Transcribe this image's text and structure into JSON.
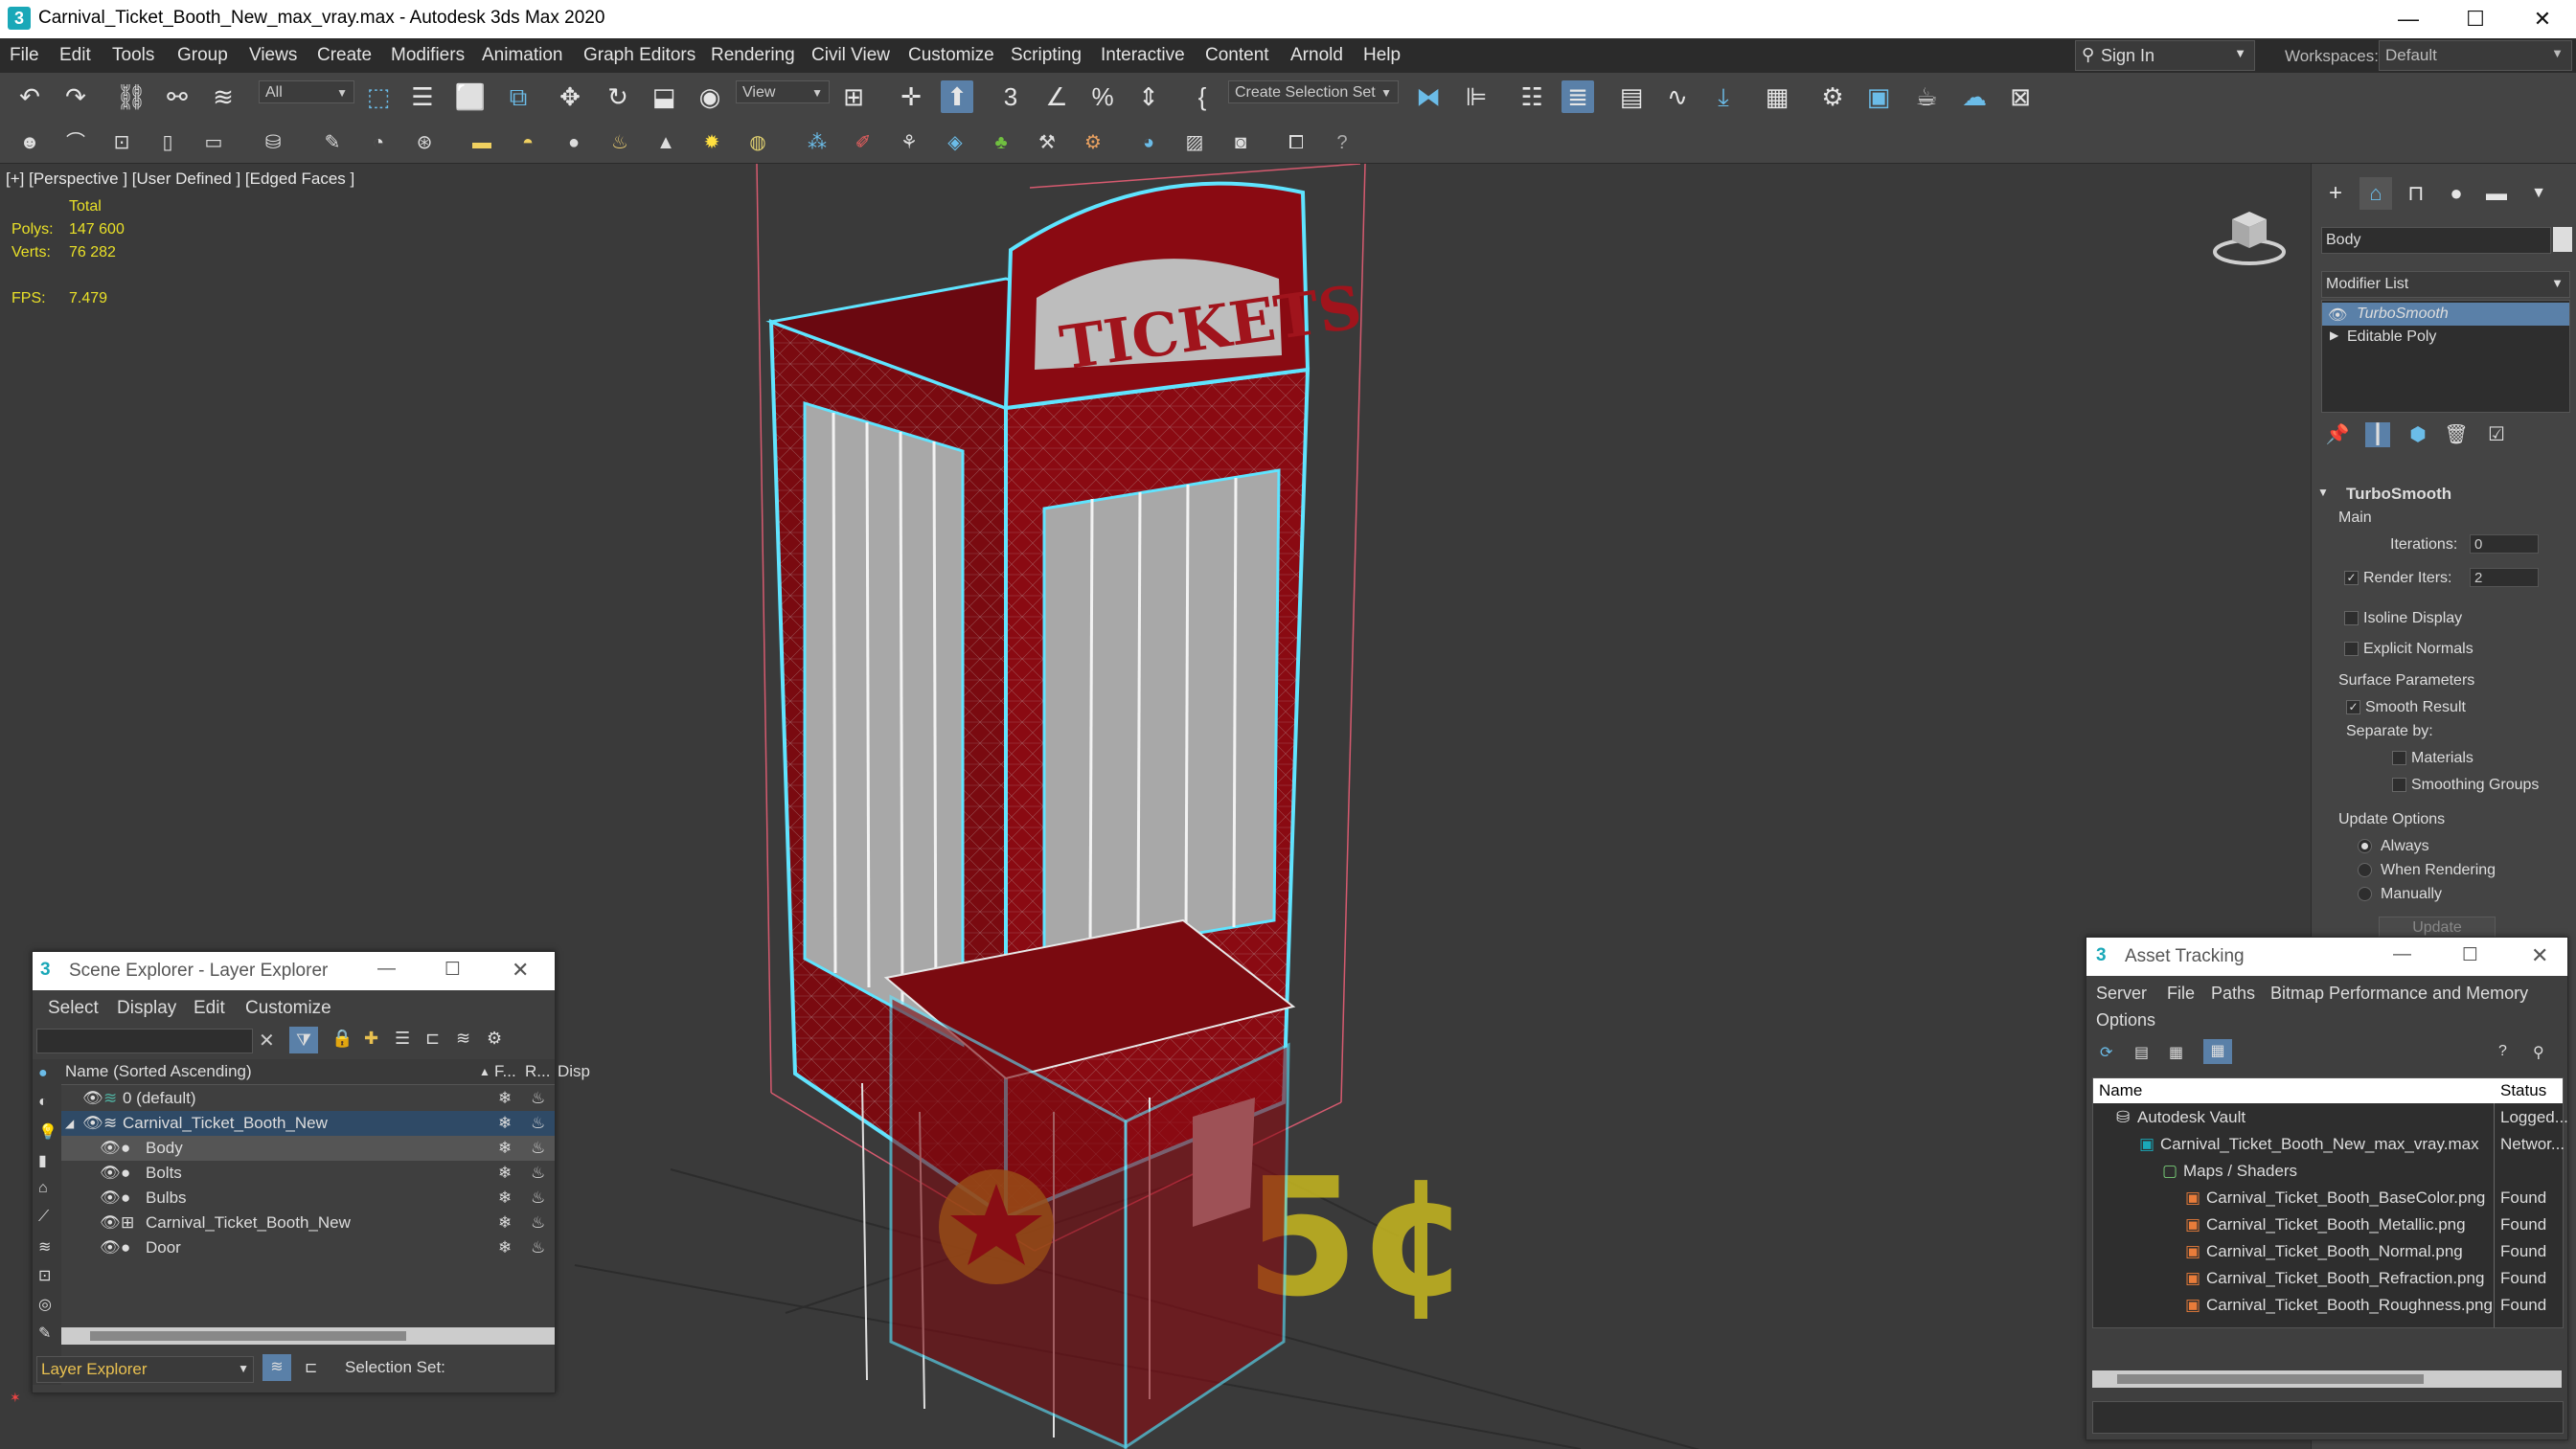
{
  "window": {
    "title": "Carnival_Ticket_Booth_New_max_vray.max - Autodesk 3ds Max 2020",
    "minimize": "—",
    "maximize": "☐",
    "close": "✕"
  },
  "menus": [
    "File",
    "Edit",
    "Tools",
    "Group",
    "Views",
    "Create",
    "Modifiers",
    "Animation",
    "Graph Editors",
    "Rendering",
    "Civil View",
    "Customize",
    "Scripting",
    "Interactive",
    "Content",
    "Arnold",
    "Help"
  ],
  "account": {
    "sign_in": "Sign In",
    "workspaces_label": "Workspaces:",
    "workspace": "Default"
  },
  "toolbar": {
    "selection_filter": "All",
    "reference_coord": "View",
    "named_selection": "Create Selection Set"
  },
  "viewport": {
    "label": "[+] [Perspective ] [User Defined ] [Edged Faces ]",
    "stats": {
      "total_label": "Total",
      "polys_label": "Polys:",
      "polys_value": "147 600",
      "verts_label": "Verts:",
      "verts_value": "76 282",
      "fps_label": "FPS:",
      "fps_value": "7.479"
    },
    "sign_text": "TICKETS",
    "price_text": "5¢"
  },
  "command_panel": {
    "object_name": "Body",
    "modifier_list": "Modifier List",
    "stack": [
      {
        "label": "TurboSmooth",
        "selected": true
      },
      {
        "label": "Editable Poly",
        "selected": false
      }
    ],
    "rollout_title": "TurboSmooth",
    "main_label": "Main",
    "iterations_label": "Iterations:",
    "iterations_value": "0",
    "render_iters_label": "Render Iters:",
    "render_iters_value": "2",
    "isoline": "Isoline Display",
    "explicit_normals": "Explicit Normals",
    "surface_params": "Surface Parameters",
    "smooth_result": "Smooth Result",
    "separate_by": "Separate by:",
    "materials": "Materials",
    "smoothing_groups": "Smoothing Groups",
    "update_options": "Update Options",
    "always": "Always",
    "when_rendering": "When Rendering",
    "manually": "Manually",
    "update_btn": "Update"
  },
  "scene_explorer": {
    "title": "Scene Explorer - Layer Explorer",
    "menus": [
      "Select",
      "Display",
      "Edit",
      "Customize"
    ],
    "col_name": "Name (Sorted Ascending)",
    "col_f": "F...",
    "col_r": "R...",
    "col_d": "Disp",
    "rows": [
      {
        "label": "0 (default)"
      },
      {
        "label": "Carnival_Ticket_Booth_New"
      },
      {
        "label": "Body"
      },
      {
        "label": "Bolts"
      },
      {
        "label": "Bulbs"
      },
      {
        "label": "Carnival_Ticket_Booth_New"
      },
      {
        "label": "Door"
      }
    ],
    "footer_combo": "Layer Explorer",
    "selection_set": "Selection Set:"
  },
  "asset_tracking": {
    "title": "Asset Tracking",
    "menus": [
      "Server",
      "File",
      "Paths",
      "Bitmap Performance and Memory",
      "Options"
    ],
    "col_name": "Name",
    "col_status": "Status",
    "rows": [
      {
        "name": "Autodesk Vault",
        "status": "Logged..."
      },
      {
        "name": "Carnival_Ticket_Booth_New_max_vray.max",
        "status": "Networ..."
      },
      {
        "name": "Maps / Shaders",
        "status": ""
      },
      {
        "name": "Carnival_Ticket_Booth_BaseColor.png",
        "status": "Found"
      },
      {
        "name": "Carnival_Ticket_Booth_Metallic.png",
        "status": "Found"
      },
      {
        "name": "Carnival_Ticket_Booth_Normal.png",
        "status": "Found"
      },
      {
        "name": "Carnival_Ticket_Booth_Refraction.png",
        "status": "Found"
      },
      {
        "name": "Carnival_Ticket_Booth_Roughness.png",
        "status": "Found"
      }
    ]
  },
  "colors": {
    "booth_red": "#8a0a12",
    "selection_cyan": "#5fe4ff",
    "stat_yellow": "#e9e028",
    "highlight_blue": "#5a80a8"
  }
}
